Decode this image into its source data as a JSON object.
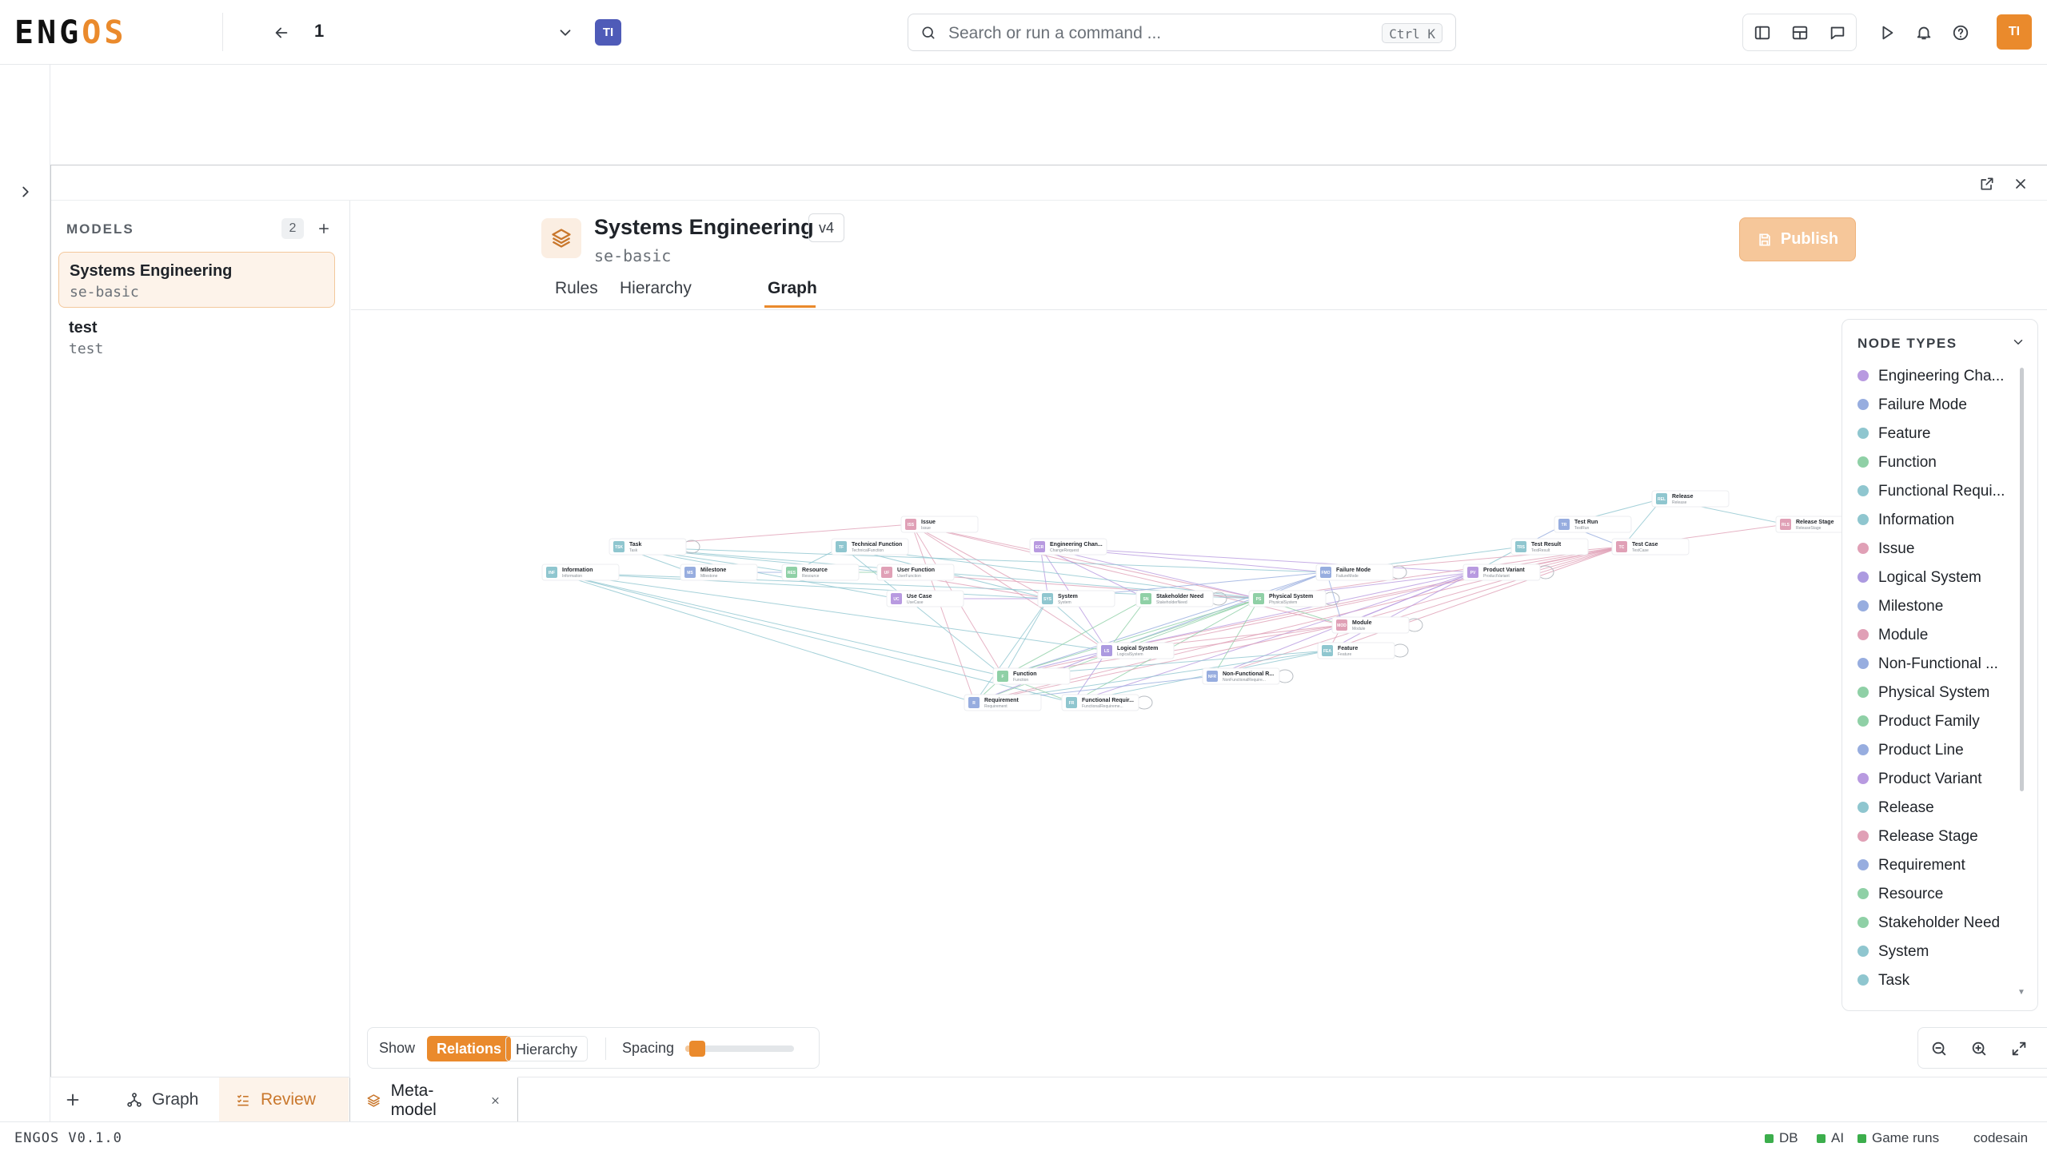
{
  "app": {
    "logo_left": "ENG",
    "logo_accent": "OS",
    "breadcrumb_value": "1",
    "workspace_avatar": "TI",
    "user_avatar": "TI"
  },
  "search": {
    "placeholder": "Search or run a command ...",
    "shortcut": "Ctrl K"
  },
  "sidebar": {
    "title": "MODELS",
    "count": "2",
    "models": [
      {
        "name": "Systems Engineering",
        "slug": "se-basic"
      },
      {
        "name": "test",
        "slug": "test"
      }
    ]
  },
  "model": {
    "title": "Systems Engineering",
    "version": "v4",
    "slug": "se-basic",
    "publish_label": "Publish",
    "tabs": [
      "Rules",
      "Hierarchy",
      "Graph"
    ]
  },
  "node_types": {
    "title": "NODE TYPES",
    "items": [
      {
        "label": "Engineering Cha...",
        "color": "#b89ae0"
      },
      {
        "label": "Failure Mode",
        "color": "#97addf"
      },
      {
        "label": "Feature",
        "color": "#8fc6cf"
      },
      {
        "label": "Function",
        "color": "#8fd0a6"
      },
      {
        "label": "Functional Requi...",
        "color": "#8fc6cf"
      },
      {
        "label": "Information",
        "color": "#8fc6cf"
      },
      {
        "label": "Issue",
        "color": "#e0a0b6"
      },
      {
        "label": "Logical System",
        "color": "#ac9ae0"
      },
      {
        "label": "Milestone",
        "color": "#97addf"
      },
      {
        "label": "Module",
        "color": "#e0a0b6"
      },
      {
        "label": "Non-Functional ...",
        "color": "#97addf"
      },
      {
        "label": "Physical System",
        "color": "#8fd0a6"
      },
      {
        "label": "Product Family",
        "color": "#8fd0a6"
      },
      {
        "label": "Product Line",
        "color": "#97addf"
      },
      {
        "label": "Product Variant",
        "color": "#b89ae0"
      },
      {
        "label": "Release",
        "color": "#8fc6cf"
      },
      {
        "label": "Release Stage",
        "color": "#e0a0b6"
      },
      {
        "label": "Requirement",
        "color": "#97addf"
      },
      {
        "label": "Resource",
        "color": "#8fd0a6"
      },
      {
        "label": "Stakeholder Need",
        "color": "#8fd0a6"
      },
      {
        "label": "System",
        "color": "#8fc6cf"
      },
      {
        "label": "Task",
        "color": "#8fc6cf"
      }
    ]
  },
  "graph": {
    "nodes": [
      {
        "abbr": "REL",
        "title": "Release",
        "sub": "Release",
        "color": "#8fc6cf"
      },
      {
        "abbr": "TR",
        "title": "Test Run",
        "sub": "TestRun",
        "color": "#97addf"
      },
      {
        "abbr": "RLS",
        "title": "Release Stage",
        "sub": "ReleaseStage",
        "color": "#e0a0b6"
      },
      {
        "abbr": "ISS",
        "title": "Issue",
        "sub": "Issue",
        "color": "#e0a0b6"
      },
      {
        "abbr": "TSK",
        "title": "Task",
        "sub": "Task",
        "color": "#8fc6cf"
      },
      {
        "abbr": "TF",
        "title": "Technical Function",
        "sub": "TechnicalFunction",
        "color": "#8fc6cf"
      },
      {
        "abbr": "ECR",
        "title": "Engineering Chan...",
        "sub": "ChangeRequest",
        "color": "#b89ae0"
      },
      {
        "abbr": "TRS",
        "title": "Test Result",
        "sub": "TestResult",
        "color": "#8fc6cf"
      },
      {
        "abbr": "TC",
        "title": "Test Case",
        "sub": "TestCase",
        "color": "#e0a0b6"
      },
      {
        "abbr": "INF",
        "title": "Information",
        "sub": "Information",
        "color": "#8fc6cf"
      },
      {
        "abbr": "MS",
        "title": "Milestone",
        "sub": "Milestone",
        "color": "#97addf"
      },
      {
        "abbr": "RES",
        "title": "Resource",
        "sub": "Resource",
        "color": "#8fd0a6"
      },
      {
        "abbr": "UF",
        "title": "User Function",
        "sub": "UserFunction",
        "color": "#e0a0b6"
      },
      {
        "abbr": "FMO",
        "title": "Failure Mode",
        "sub": "FailureMode",
        "color": "#97addf"
      },
      {
        "abbr": "PV",
        "title": "Product Variant",
        "sub": "ProductVariant",
        "color": "#b89ae0"
      },
      {
        "abbr": "UC",
        "title": "Use Case",
        "sub": "UseCase",
        "color": "#b89ae0"
      },
      {
        "abbr": "SYS",
        "title": "System",
        "sub": "System",
        "color": "#8fc6cf"
      },
      {
        "abbr": "SN",
        "title": "Stakeholder Need",
        "sub": "StakeholderNeed",
        "color": "#8fd0a6"
      },
      {
        "abbr": "PS",
        "title": "Physical System",
        "sub": "PhysicalSystem",
        "color": "#8fd0a6"
      },
      {
        "abbr": "MOD",
        "title": "Module",
        "sub": "Module",
        "color": "#e0a0b6"
      },
      {
        "abbr": "LS",
        "title": "Logical System",
        "sub": "LogicalSystem",
        "color": "#ac9ae0"
      },
      {
        "abbr": "FEA",
        "title": "Feature",
        "sub": "Feature",
        "color": "#8fc6cf"
      },
      {
        "abbr": "F",
        "title": "Function",
        "sub": "Function",
        "color": "#8fd0a6"
      },
      {
        "abbr": "NFR",
        "title": "Non-Functional R...",
        "sub": "NonFunctionalRequire...",
        "color": "#97addf"
      },
      {
        "abbr": "R",
        "title": "Requirement",
        "sub": "Requirement",
        "color": "#97addf"
      },
      {
        "abbr": "FR",
        "title": "Functional Requir...",
        "sub": "FunctionalRequireme...",
        "color": "#8fc6cf"
      }
    ]
  },
  "controls": {
    "show_label": "Show",
    "relations_label": "Relations",
    "hierarchy_label": "Hierarchy",
    "spacing_label": "Spacing",
    "spacing_value": 0.05
  },
  "bottom_tabs": {
    "graph": "Graph",
    "review": "Review",
    "metamodel": "Meta-model"
  },
  "status": {
    "version": "ENGOS V0.1.0",
    "db": "DB",
    "ai": "AI",
    "game": "Game runs",
    "user": "codesain"
  },
  "colors": {
    "accent": "#ea8a2c",
    "status_ok": "#3cae4c"
  }
}
